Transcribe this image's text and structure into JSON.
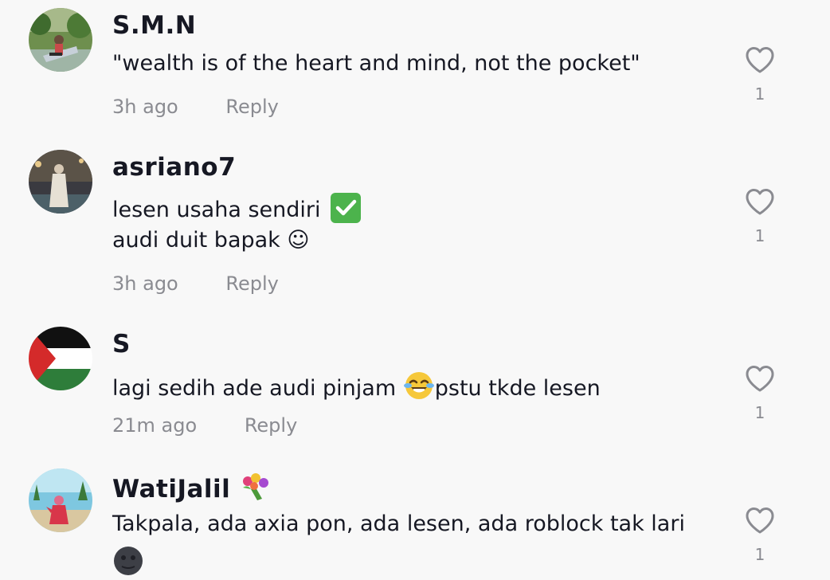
{
  "comments": [
    {
      "username": "S.M.N",
      "lines": [
        "\"wealth is of the heart and mind, not the pocket\""
      ],
      "time": "3h ago",
      "reply": "Reply",
      "likes": "1",
      "avatar_icon": "garden-photo-avatar"
    },
    {
      "username": "asriano7",
      "lines": [
        "lesen usaha sendiri",
        "audi duit bapak ☺"
      ],
      "time": "3h ago",
      "reply": "Reply",
      "likes": "1",
      "avatar_icon": "person-photo-avatar",
      "emoji_icon": "check-mark-emoji"
    },
    {
      "username": "S",
      "lines": [
        "lagi sedih ade audi pinjam ",
        "pstu tkde lesen"
      ],
      "time": "21m ago",
      "reply": "Reply",
      "likes": "1",
      "avatar_icon": "palestine-flag-avatar",
      "emoji_icon": "tears-of-joy-emoji"
    },
    {
      "username": "WatiJalil",
      "lines": [
        "Takpala, ada axia pon, ada lesen, ada roblock tak lari"
      ],
      "likes": "1",
      "avatar_icon": "beach-photo-avatar",
      "emoji_icon": "bouquet-emoji"
    }
  ],
  "colors": {
    "background": "#f8f8f8",
    "text": "#161823",
    "muted": "#8a8b91"
  }
}
